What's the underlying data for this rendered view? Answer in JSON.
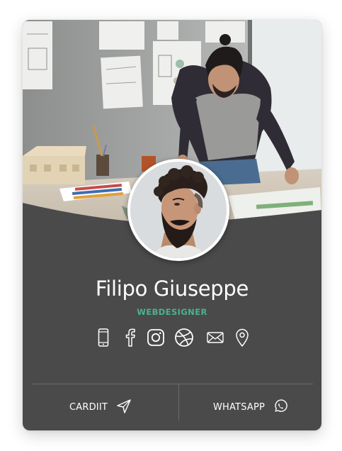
{
  "profile": {
    "name": "Filipo Giuseppe",
    "title": "WEBDESIGNER"
  },
  "socials": [
    {
      "icon": "phone-icon"
    },
    {
      "icon": "facebook-icon"
    },
    {
      "icon": "instagram-icon"
    },
    {
      "icon": "dribbble-icon"
    },
    {
      "icon": "mail-icon"
    },
    {
      "icon": "location-pin-icon"
    }
  ],
  "actions": {
    "left_label": "CARDIIT",
    "left_icon": "send-icon",
    "right_label": "WHATSAPP",
    "right_icon": "whatsapp-icon"
  },
  "colors": {
    "card_background": "#4a4a4b",
    "accent": "#4bb28f",
    "text": "#ffffff"
  }
}
